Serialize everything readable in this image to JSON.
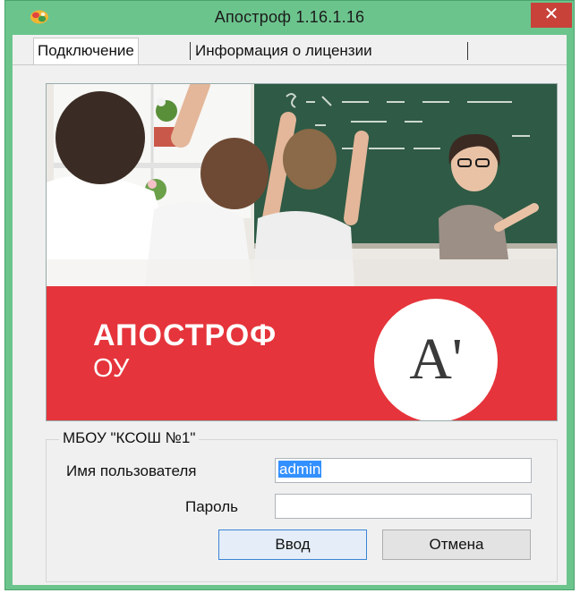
{
  "window": {
    "title": "Апостроф 1.16.1.16",
    "close_glyph": "✕"
  },
  "tabs": [
    {
      "label": "Подключение",
      "active": true
    },
    {
      "label": "Информация о лицензии",
      "active": false
    }
  ],
  "banner": {
    "brand_name": "АПОСТРОФ",
    "brand_sub": "ОУ",
    "logo_text": "A'",
    "brand_color": "#e5343b"
  },
  "login": {
    "group_title": "МБОУ \"КСОШ №1\"",
    "username_label": "Имя пользователя",
    "username_value": "admin",
    "password_label": "Пароль",
    "password_value": "",
    "ok_label": "Ввод",
    "cancel_label": "Отмена"
  },
  "icons": {
    "app": "app-logo-icon",
    "close": "close-icon"
  }
}
